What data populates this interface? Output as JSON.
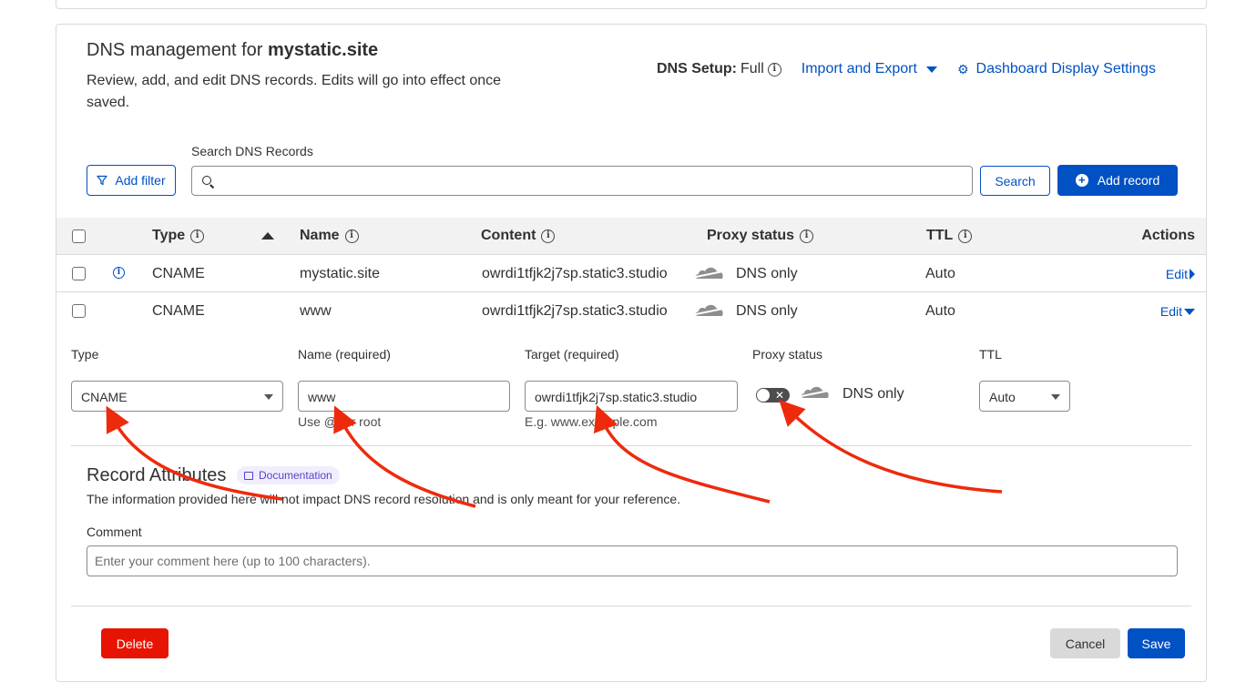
{
  "header": {
    "title_prefix": "DNS management for",
    "domain": "mystatic.site",
    "subtitle": "Review, add, and edit DNS records. Edits will go into effect once saved.",
    "dns_setup_label": "DNS Setup:",
    "dns_setup_value": "Full",
    "import_export": "Import and Export",
    "dashboard_settings": "Dashboard Display Settings"
  },
  "toolbar": {
    "add_filter": "Add filter",
    "search_label": "Search DNS Records",
    "search_placeholder": "",
    "search_button": "Search",
    "add_record": "Add record"
  },
  "table": {
    "columns": {
      "type": "Type",
      "name": "Name",
      "content": "Content",
      "proxy_status": "Proxy status",
      "ttl": "TTL",
      "actions": "Actions"
    },
    "rows": [
      {
        "type": "CNAME",
        "name": "mystatic.site",
        "content": "owrdi1tfjk2j7sp.static3.studio",
        "proxy": "DNS only",
        "ttl": "Auto",
        "action": "Edit"
      },
      {
        "type": "CNAME",
        "name": "www",
        "content": "owrdi1tfjk2j7sp.static3.studio",
        "proxy": "DNS only",
        "ttl": "Auto",
        "action": "Edit"
      }
    ]
  },
  "edit_form": {
    "type_label": "Type",
    "type_value": "CNAME",
    "name_label": "Name (required)",
    "name_value": "www",
    "name_hint": "Use @ for root",
    "target_label": "Target (required)",
    "target_value": "owrdi1tfjk2j7sp.static3.studio",
    "target_hint": "E.g. www.example.com",
    "proxy_label": "Proxy status",
    "proxy_value": "DNS only",
    "ttl_label": "TTL",
    "ttl_value": "Auto"
  },
  "record_attributes": {
    "title": "Record Attributes",
    "doc_badge": "Documentation",
    "description": "The information provided here will not impact DNS record resolution and is only meant for your reference.",
    "comment_label": "Comment",
    "comment_placeholder": "Enter your comment here (up to 100 characters)."
  },
  "footer": {
    "delete": "Delete",
    "cancel": "Cancel",
    "save": "Save"
  },
  "colors": {
    "accent": "#0051c3",
    "danger": "#e81403",
    "annotation_arrow": "#ee2a0c"
  }
}
